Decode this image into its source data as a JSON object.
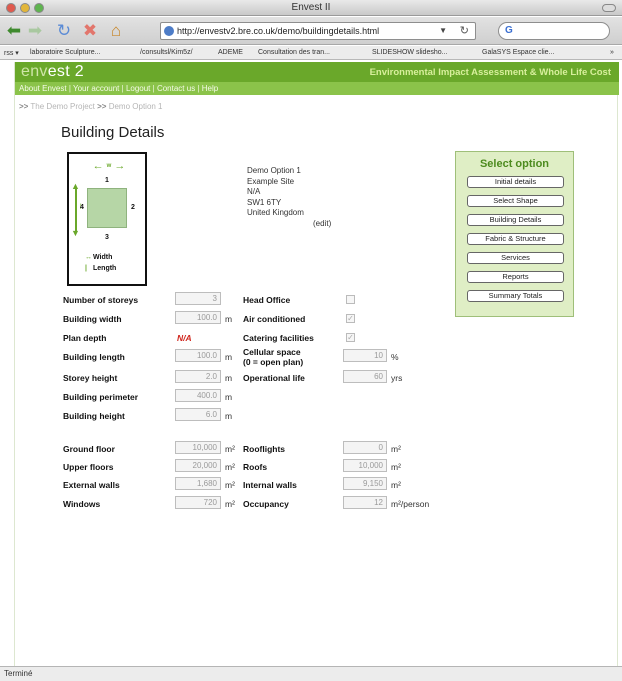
{
  "window": {
    "title": "Envest II"
  },
  "toolbar": {
    "url": "http://envestv2.bre.co.uk/demo/buildingdetails.html"
  },
  "bookmarks": [
    "rss ▾",
    "laboratoire Sculpture...",
    "/consultsl/Kim5z/",
    "ADEME",
    "Consultation des tran...",
    "SLIDESHOW slidesho...",
    "GalaSYS Espace clie...",
    "»"
  ],
  "site": {
    "logo_prefix": "env",
    "logo_suffix": "est 2",
    "tagline": "Environmental Impact Assessment & Whole Life Cost",
    "nav": [
      "About Envest",
      "Your account",
      "Logout",
      "Contact us",
      "Help"
    ],
    "nav_separator": "|",
    "breadcrumb": {
      "sep": ">>",
      "items": [
        "The Demo Project",
        "Demo Option 1"
      ]
    }
  },
  "page": {
    "title": "Building Details"
  },
  "diagram": {
    "width_label": "w",
    "length_label": "l",
    "side_labels": [
      "1",
      "2",
      "3",
      "4"
    ],
    "key_width": "Width",
    "key_length": "Length",
    "key_width_mark": "↔",
    "key_length_mark": "|"
  },
  "address": {
    "lines": [
      "Demo Option 1",
      "Example Site",
      "N/A",
      "SW1 6TY",
      "United Kingdom"
    ],
    "edit": "(edit)"
  },
  "select_option": {
    "title": "Select option",
    "items": [
      "Initial details",
      "Select Shape",
      "Building Details",
      "Fabric & Structure",
      "Services",
      "Reports",
      "Summary Totals"
    ]
  },
  "form": {
    "left": [
      {
        "label": "Number of storeys",
        "value": "3",
        "unit": ""
      },
      {
        "label": "Building width",
        "value": "100.0",
        "unit": "m"
      },
      {
        "label": "Plan depth",
        "value": "N/A",
        "unit": ""
      },
      {
        "label": "Building length",
        "value": "100.0",
        "unit": "m"
      },
      {
        "label": "Storey height",
        "value": "2.0",
        "unit": "m"
      },
      {
        "label": "Building perimeter",
        "value": "400.0",
        "unit": "m"
      },
      {
        "label": "Building height",
        "value": "6.0",
        "unit": "m"
      }
    ],
    "right": [
      {
        "label": "Head Office",
        "checked": false
      },
      {
        "label": "Air conditioned",
        "checked": true
      },
      {
        "label": "Catering facilities",
        "checked": true
      },
      {
        "label": "Cellular space",
        "label2": "(0 = open plan)",
        "value": "10",
        "unit": "%"
      },
      {
        "label": "Operational life",
        "value": "60",
        "unit": "yrs"
      }
    ],
    "areas_left": [
      {
        "label": "Ground floor",
        "value": "10,000",
        "unit": "m²"
      },
      {
        "label": "Upper floors",
        "value": "20,000",
        "unit": "m²"
      },
      {
        "label": "External walls",
        "value": "1,680",
        "unit": "m²"
      },
      {
        "label": "Windows",
        "value": "720",
        "unit": "m²"
      }
    ],
    "areas_right": [
      {
        "label": "Rooflights",
        "value": "0",
        "unit": "m²"
      },
      {
        "label": "Roofs",
        "value": "10,000",
        "unit": "m²"
      },
      {
        "label": "Internal walls",
        "value": "9,150",
        "unit": "m²"
      },
      {
        "label": "Occupancy",
        "value": "12",
        "unit": "m²/person"
      }
    ]
  },
  "statusbar": {
    "text": "Terminé"
  }
}
